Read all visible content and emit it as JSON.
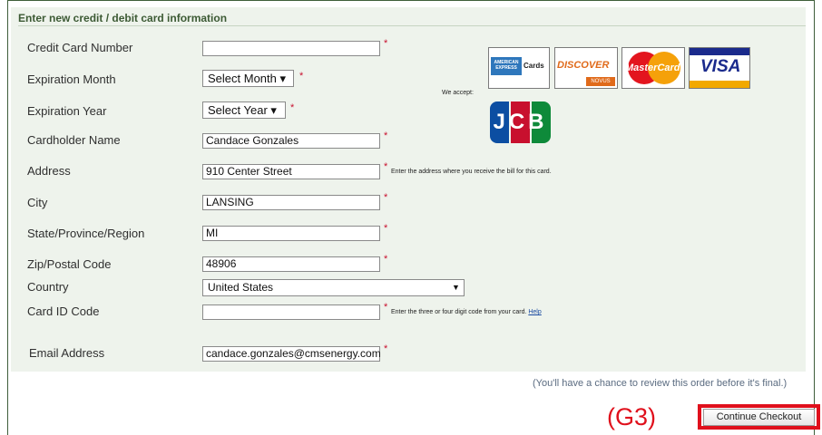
{
  "form": {
    "title": "Enter new credit / debit card information",
    "required_mark": "*",
    "fields": {
      "card_number": {
        "label": "Credit Card Number",
        "value": ""
      },
      "exp_month": {
        "label": "Expiration Month",
        "value": "Select Month ▾"
      },
      "exp_year": {
        "label": "Expiration Year",
        "value": "Select Year ▾"
      },
      "cardholder": {
        "label": "Cardholder Name",
        "value": "Candace Gonzales"
      },
      "address": {
        "label": "Address",
        "value": "910 Center Street",
        "hint": "Enter the address where you receive the bill for this card."
      },
      "city": {
        "label": "City",
        "value": "LANSING"
      },
      "state": {
        "label": "State/Province/Region",
        "value": "MI"
      },
      "zip": {
        "label": "Zip/Postal Code",
        "value": "48906"
      },
      "country": {
        "label": "Country",
        "value": "United States"
      },
      "card_id": {
        "label": "Card ID Code",
        "value": "",
        "hint": "Enter the three or four digit code from your card.",
        "help_link": "Help"
      },
      "email": {
        "label": "Email Address",
        "value": "candace.gonzales@cmsenergy.com"
      }
    },
    "we_accept": "We accept:",
    "cards": {
      "amex": "AMERICAN EXPRESS",
      "amex_suffix": "Cards",
      "discover": "DISCOVER",
      "discover_sub": "NOVUS",
      "mastercard": "MasterCard",
      "visa": "VISA",
      "jcb": "JCB"
    }
  },
  "footer": {
    "review_note": "(You'll have a chance to review this order before it's final.)",
    "annotation": "(G3)",
    "continue_button": "Continue Checkout"
  },
  "colors": {
    "panel_bg": "#eef3ec",
    "title": "#3c5a34",
    "required": "#c8102e",
    "annotation": "#e0101c"
  }
}
